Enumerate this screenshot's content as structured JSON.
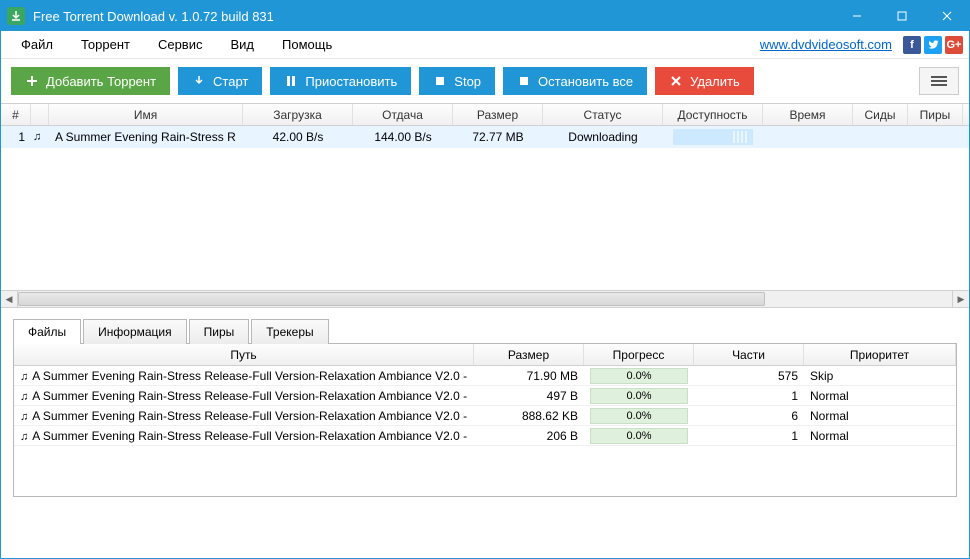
{
  "titlebar": {
    "title": "Free Torrent Download v. 1.0.72 build 831"
  },
  "menubar": {
    "items": [
      "Файл",
      "Торрент",
      "Сервис",
      "Вид",
      "Помощь"
    ],
    "link": "www.dvdvideosoft.com"
  },
  "toolbar": {
    "add": "Добавить Торрент",
    "start": "Старт",
    "pause": "Приостановить",
    "stop": "Stop",
    "stopall": "Остановить все",
    "delete": "Удалить"
  },
  "torrents": {
    "headers": [
      "#",
      "",
      "Имя",
      "Загрузка",
      "Отдача",
      "Размер",
      "Статус",
      "Доступность",
      "Время",
      "Сиды",
      "Пиры"
    ],
    "row": {
      "num": "1",
      "name": "A Summer Evening Rain-Stress R",
      "download": "42.00 B/s",
      "upload": "144.00 B/s",
      "size": "72.77 MB",
      "status": "Downloading"
    }
  },
  "tabs": {
    "files": "Файлы",
    "info": "Информация",
    "peers": "Пиры",
    "trackers": "Трекеры"
  },
  "files": {
    "headers": [
      "Путь",
      "Размер",
      "Прогресс",
      "Части",
      "Приоритет"
    ],
    "rows": [
      {
        "path": "A Summer Evening Rain-Stress Release-Full Version-Relaxation Ambiance V2.0 -",
        "size": "71.90 MB",
        "progress": "0.0%",
        "parts": "575",
        "priority": "Skip"
      },
      {
        "path": "A Summer Evening Rain-Stress Release-Full Version-Relaxation Ambiance V2.0 -",
        "size": "497 B",
        "progress": "0.0%",
        "parts": "1",
        "priority": "Normal"
      },
      {
        "path": "A Summer Evening Rain-Stress Release-Full Version-Relaxation Ambiance V2.0 -",
        "size": "888.62 KB",
        "progress": "0.0%",
        "parts": "6",
        "priority": "Normal"
      },
      {
        "path": "A Summer Evening Rain-Stress Release-Full Version-Relaxation Ambiance V2.0 -",
        "size": "206 B",
        "progress": "0.0%",
        "parts": "1",
        "priority": "Normal"
      }
    ]
  }
}
